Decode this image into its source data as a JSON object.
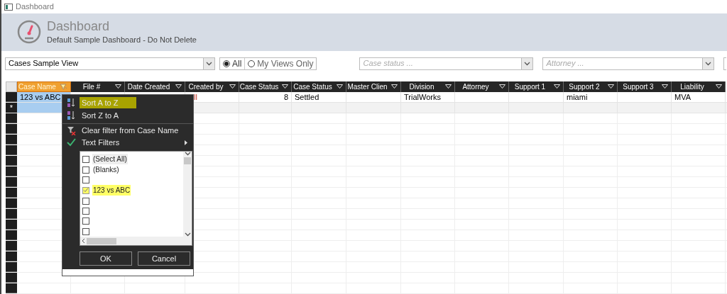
{
  "window": {
    "title": "Dashboard"
  },
  "header": {
    "title": "Dashboard",
    "subtitle": "Default Sample Dashboard - Do Not Delete"
  },
  "toolbar": {
    "view": "Cases Sample View",
    "scope": [
      {
        "label": "All",
        "selected": true
      },
      {
        "label": "My Views Only",
        "selected": false
      }
    ],
    "case_status": {
      "placeholder": "Case status ..."
    },
    "attorney": {
      "placeholder": "Attorney ..."
    }
  },
  "table": {
    "columns": [
      {
        "label": "Case Name",
        "filtered": true
      },
      {
        "label": "File #",
        "filtered": false
      },
      {
        "label": "Date Created",
        "filtered": false
      },
      {
        "label": "Created by",
        "filtered": false
      },
      {
        "label": "Case Status",
        "filtered": false
      },
      {
        "label": "Case Status",
        "filtered": false
      },
      {
        "label": "Master Clien",
        "filtered": false
      },
      {
        "label": "Division",
        "filtered": false
      },
      {
        "label": "Attorney",
        "filtered": false
      },
      {
        "label": "Support 1",
        "filtered": false
      },
      {
        "label": "Support 2",
        "filtered": false
      },
      {
        "label": "Support 3",
        "filtered": false
      },
      {
        "label": "Liability",
        "filtered": false
      }
    ],
    "rows": [
      {
        "cells": [
          "123 vs ABC",
          "",
          "",
          "ll",
          "8",
          "Settled",
          "",
          "TrialWorks",
          "",
          "",
          "miami",
          "",
          "MVA"
        ]
      }
    ],
    "new_row_marker": "*"
  },
  "filter_menu": {
    "items": [
      {
        "kind": "sort-asc",
        "label": "Sort A to Z",
        "highlighted": true
      },
      {
        "kind": "sort-desc",
        "label": "Sort Z to A",
        "highlighted": false
      },
      {
        "kind": "clear",
        "label": "Clear filter from Case Name",
        "highlighted": false
      },
      {
        "kind": "submenu",
        "label": "Text Filters",
        "highlighted": false
      }
    ],
    "values": [
      {
        "label": "(Select All)",
        "checked": false,
        "highlighted": false
      },
      {
        "label": "(Blanks)",
        "checked": false,
        "highlighted": false
      },
      {
        "checked": false,
        "highlighted": false
      },
      {
        "label": "123 vs ABC",
        "checked": true,
        "highlighted": true
      },
      {
        "checked": false,
        "highlighted": false
      },
      {
        "checked": false,
        "highlighted": false
      },
      {
        "checked": false,
        "highlighted": false
      },
      {
        "checked": false,
        "highlighted": false
      }
    ],
    "buttons": [
      "OK",
      "Cancel"
    ]
  }
}
